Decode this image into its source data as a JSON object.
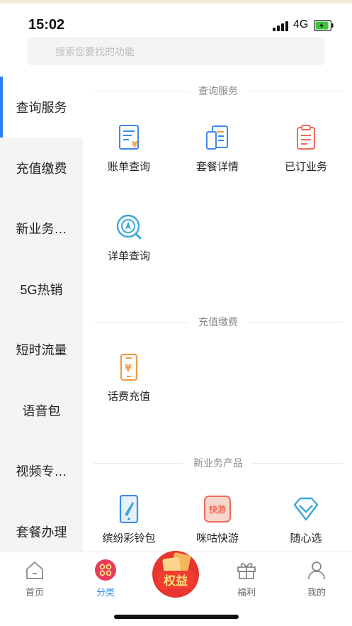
{
  "status": {
    "time": "15:02",
    "network": "4G"
  },
  "search": {
    "placeholder": "搜索您要找的功能"
  },
  "sidebar": {
    "items": [
      {
        "label": "查询服务",
        "active": true
      },
      {
        "label": "充值缴费"
      },
      {
        "label": "新业务…"
      },
      {
        "label": "5G热销"
      },
      {
        "label": "短时流量"
      },
      {
        "label": "语音包"
      },
      {
        "label": "视频专…"
      },
      {
        "label": "套餐办理"
      }
    ]
  },
  "sections": [
    {
      "title": "查询服务",
      "tiles": [
        {
          "label": "账单查询",
          "icon": "bill-icon"
        },
        {
          "label": "套餐详情",
          "icon": "package-detail-icon"
        },
        {
          "label": "已订业务",
          "icon": "clipboard-icon"
        },
        {
          "label": "详单查询",
          "icon": "target-search-icon"
        }
      ]
    },
    {
      "title": "充值缴费",
      "tiles": [
        {
          "label": "话费充值",
          "icon": "phone-recharge-icon"
        }
      ]
    },
    {
      "title": "新业务产品",
      "tiles": [
        {
          "label": "缤纷彩铃包",
          "icon": "ringtone-phone-icon"
        },
        {
          "label": "咪咕快游",
          "icon": "migu-game-icon",
          "badge_text": "快游"
        },
        {
          "label": "随心选",
          "icon": "diamond-icon"
        }
      ]
    }
  ],
  "tabbar": {
    "items": [
      {
        "label": "首页",
        "icon": "home-icon"
      },
      {
        "label": "分类",
        "icon": "category-icon",
        "active": true
      },
      {
        "label": "福利",
        "icon": "gift-icon"
      },
      {
        "label": "我的",
        "icon": "user-icon"
      }
    ],
    "center": {
      "badge_text": "权益",
      "icon": "rights-badge-icon"
    }
  },
  "colors": {
    "accent_blue": "#2d7ff9",
    "tab_active": "#2d8ef0",
    "orange": "#f29a4a",
    "red": "#ee6a5a",
    "category_red": "#e83a5a"
  }
}
